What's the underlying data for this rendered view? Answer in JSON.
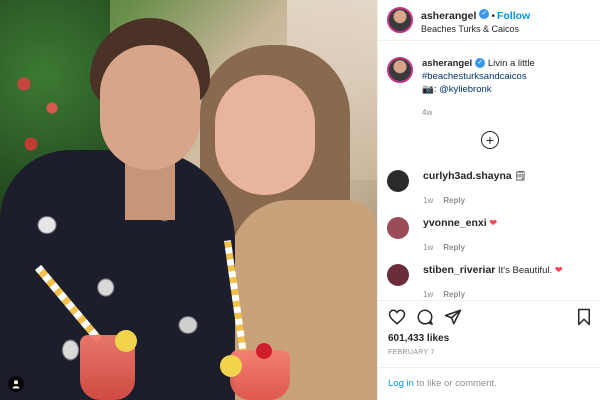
{
  "post": {
    "username": "asherangel",
    "follow_label": "Follow",
    "location": "Beaches Turks & Caicos",
    "caption": {
      "username": "asherangel",
      "text": "Livin a little",
      "hashtag": "#beachesturksandcaicos",
      "camera_emoji": "📷",
      "mention_prefix": ":",
      "mention": "@kyliebronk",
      "time": "4w"
    },
    "comments": [
      {
        "username": "curlyh3ad.shayna",
        "text": "🗒",
        "time": "1w",
        "reply_label": "Reply",
        "avatar_color": "#2b2b2b"
      },
      {
        "username": "yvonne_enxi",
        "text": "",
        "heart": "❤",
        "time": "1w",
        "reply_label": "Reply",
        "avatar_color": "#9b4a5a"
      },
      {
        "username": "stiben_riveriar",
        "text": "It's Beautiful.",
        "heart": "❤",
        "time": "1w",
        "reply_label": "Reply",
        "avatar_color": "#6b2d3a"
      }
    ],
    "load_more_symbol": "+",
    "likes": "601,433 likes",
    "date": "FEBRUARY 7",
    "login_link": "Log in",
    "login_suffix": " to like or comment."
  },
  "colors": {
    "link_blue": "#0095f6",
    "verified_blue": "#3897f0",
    "heart_red": "#ed4956",
    "muted_gray": "#8e8e8e"
  }
}
